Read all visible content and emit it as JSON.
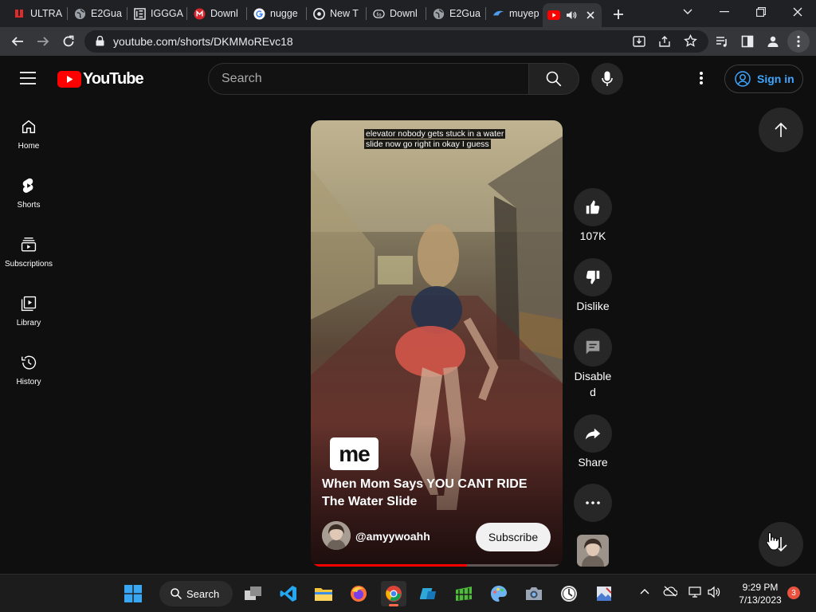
{
  "browser": {
    "tabs": [
      {
        "label": "ULTRA",
        "icon": "ultra-favicon"
      },
      {
        "label": "E2Gua",
        "icon": "globe-favicon"
      },
      {
        "label": "IGGGA",
        "icon": "igg-favicon"
      },
      {
        "label": "Downl",
        "icon": "mega-favicon"
      },
      {
        "label": "nugge",
        "icon": "google-favicon"
      },
      {
        "label": "New T",
        "icon": "chrome-favicon"
      },
      {
        "label": "Downl",
        "icon": "download-favicon"
      },
      {
        "label": "E2Gua",
        "icon": "globe-favicon"
      },
      {
        "label": "muyep",
        "icon": "blue-favicon"
      }
    ],
    "active_tab": {
      "icon": "youtube-favicon",
      "audio": "speaker-icon"
    },
    "url": "youtube.com/shorts/DKMMoREvc18"
  },
  "youtube": {
    "logo_text": "YouTube",
    "search_placeholder": "Search",
    "sign_in": "Sign in",
    "guide": [
      {
        "label": "Home",
        "icon": "home-icon"
      },
      {
        "label": "Shorts",
        "icon": "shorts-icon"
      },
      {
        "label": "Subscriptions",
        "icon": "subscriptions-icon"
      },
      {
        "label": "Library",
        "icon": "library-icon"
      },
      {
        "label": "History",
        "icon": "history-icon"
      }
    ]
  },
  "short": {
    "caption_line1": "elevator nobody gets stuck in a water",
    "caption_line2": "slide now go right in okay I guess",
    "overlay_logo": "me",
    "title": "When Mom Says YOU CANT RIDE The Water Slide",
    "channel": "@amyywoahh",
    "subscribe": "Subscribe",
    "progress_fraction": 0.62
  },
  "actions": {
    "likes": "107K",
    "dislike": "Dislike",
    "comments_line1": "Disable",
    "comments_line2": "d",
    "share": "Share"
  },
  "taskbar": {
    "search": "Search",
    "time": "9:29 PM",
    "date": "7/13/2023",
    "notifications": "3"
  },
  "colors": {
    "youtube_red": "#ff0000",
    "link_blue": "#3ea6ff",
    "background": "#0f0f0f"
  }
}
